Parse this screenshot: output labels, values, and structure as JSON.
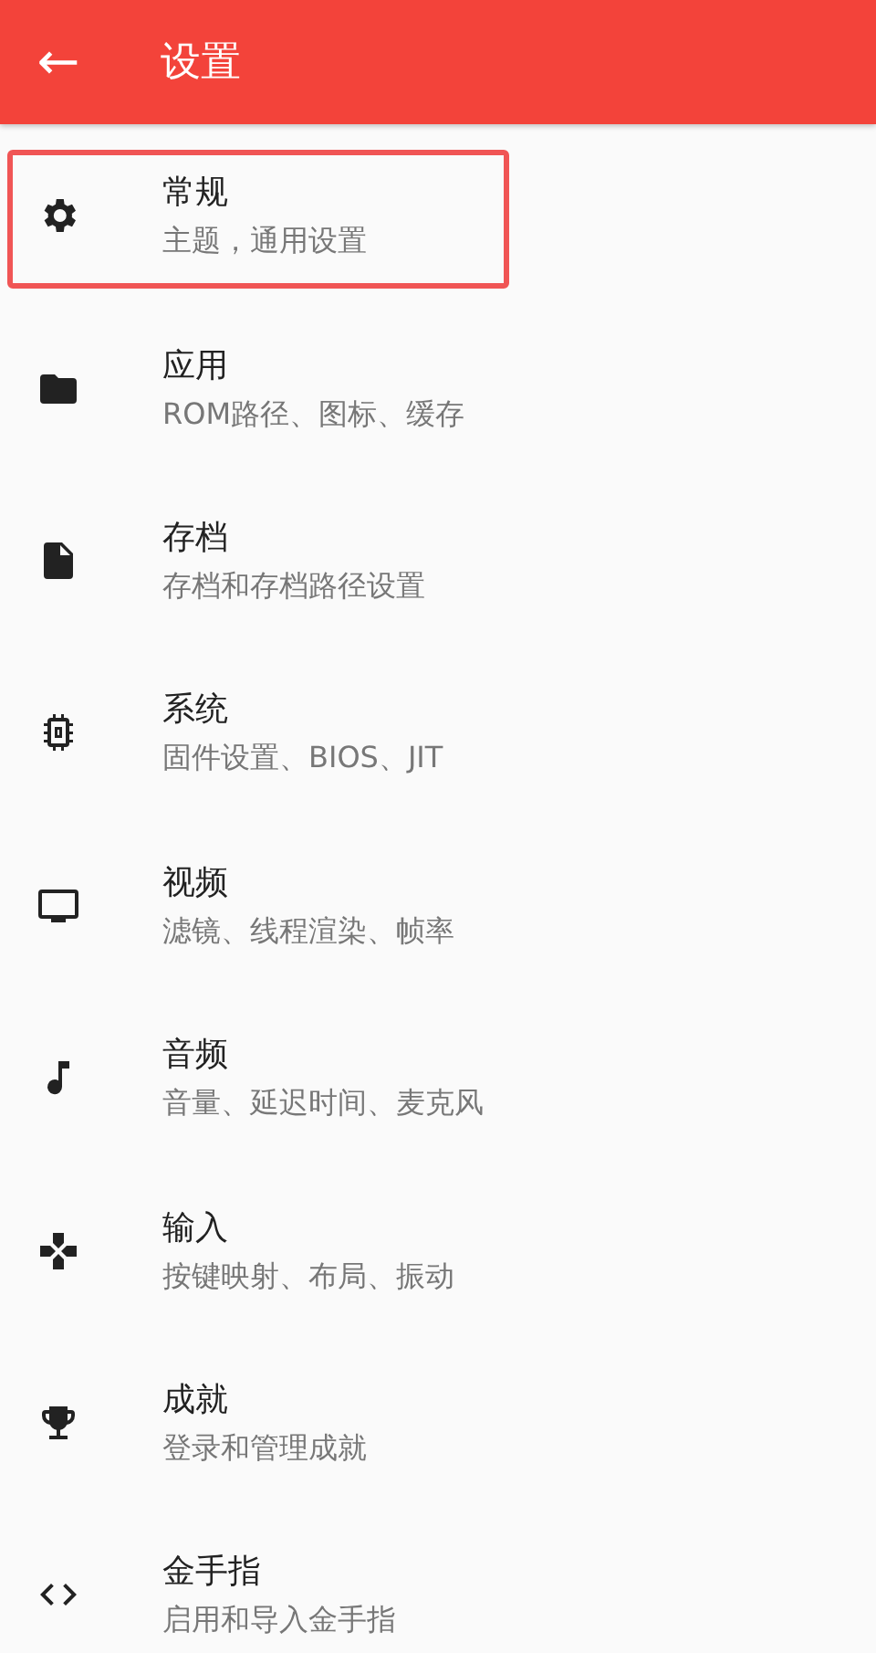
{
  "app_bar": {
    "back_icon": "←",
    "title": "设置"
  },
  "items": [
    {
      "kind": "gear",
      "title": "常规",
      "subtitle": "主题，通用设置",
      "highlighted": true
    },
    {
      "kind": "folder",
      "title": "应用",
      "subtitle": "ROM路径、图标、缓存",
      "highlighted": false
    },
    {
      "kind": "file",
      "title": "存档",
      "subtitle": "存档和存档路径设置",
      "highlighted": false
    },
    {
      "kind": "chip",
      "title": "系统",
      "subtitle": "固件设置、BIOS、JIT",
      "highlighted": false
    },
    {
      "kind": "monitor",
      "title": "视频",
      "subtitle": "滤镜、线程渲染、帧率",
      "highlighted": false
    },
    {
      "kind": "note",
      "title": "音频",
      "subtitle": "音量、延迟时间、麦克风",
      "highlighted": false
    },
    {
      "kind": "gamepad",
      "title": "输入",
      "subtitle": "按键映射、布局、振动",
      "highlighted": false
    },
    {
      "kind": "trophy",
      "title": "成就",
      "subtitle": "登录和管理成就",
      "highlighted": false
    },
    {
      "kind": "code",
      "title": "金手指",
      "subtitle": "启用和导入金手指",
      "highlighted": false
    }
  ]
}
